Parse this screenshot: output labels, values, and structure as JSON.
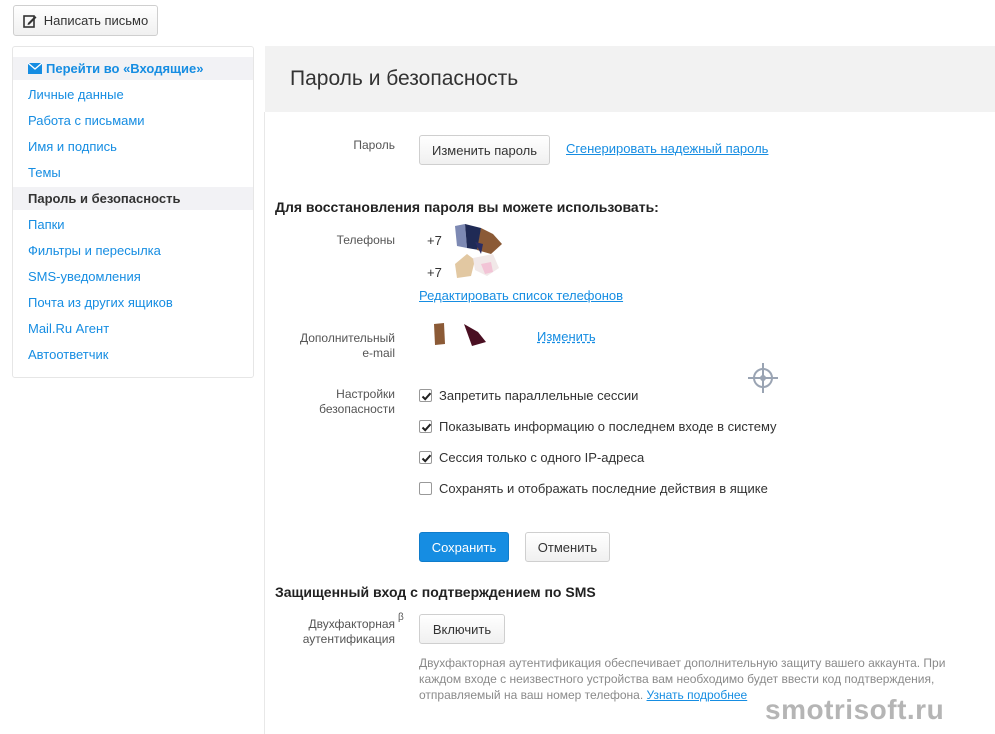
{
  "toolbar": {
    "compose_label": "Написать письмо"
  },
  "sidebar": {
    "items": [
      {
        "label": "Перейти во «Входящие»"
      },
      {
        "label": "Личные данные"
      },
      {
        "label": "Работа с письмами"
      },
      {
        "label": "Имя и подпись"
      },
      {
        "label": "Темы"
      },
      {
        "label": "Пароль и безопасность"
      },
      {
        "label": "Папки"
      },
      {
        "label": "Фильтры и пересылка"
      },
      {
        "label": "SMS-уведомления"
      },
      {
        "label": "Почта из других ящиков"
      },
      {
        "label": "Mail.Ru Агент"
      },
      {
        "label": "Автоответчик"
      }
    ]
  },
  "page": {
    "title": "Пароль и безопасность"
  },
  "password": {
    "label": "Пароль",
    "change_button": "Изменить пароль",
    "generate_link": "Сгенерировать надежный пароль"
  },
  "recovery": {
    "title": "Для восстановления пароля вы можете использовать:",
    "phones_label": "Телефоны",
    "phones": [
      "+7",
      "+7"
    ],
    "edit_phones_link": "Редактировать список телефонов",
    "extra_email_label_1": "Дополнительный",
    "extra_email_label_2": "e-mail",
    "change_link": "Изменить"
  },
  "security": {
    "label_1": "Настройки",
    "label_2": "безопасности",
    "options": [
      {
        "label": "Запретить параллельные сессии",
        "checked": true
      },
      {
        "label": "Показывать информацию о последнем входе в систему",
        "checked": true
      },
      {
        "label": "Сессия только с одного IP-адреса",
        "checked": true
      },
      {
        "label": "Сохранять и отображать последние действия в ящике",
        "checked": false
      }
    ]
  },
  "actions": {
    "save": "Сохранить",
    "cancel": "Отменить"
  },
  "two_factor": {
    "title": "Защищенный вход с подтверждением по SMS",
    "label_1": "Двухфакторная",
    "label_2": "аутентификация",
    "beta": "β",
    "enable_button": "Включить",
    "description": "Двухфакторная аутентификация обеспечивает дополнительную защиту вашего аккаунта. При каждом входе с неизвестного устройства вам необходимо будет ввести код подтверждения, отправляемый на ваш номер телефона.",
    "learn_more": "Узнать подробнее"
  },
  "watermark": "smotrisoft.ru",
  "colors": {
    "accent": "#168de2",
    "header_bg": "#f2f2f2",
    "active_bg": "#f2f2f5"
  }
}
